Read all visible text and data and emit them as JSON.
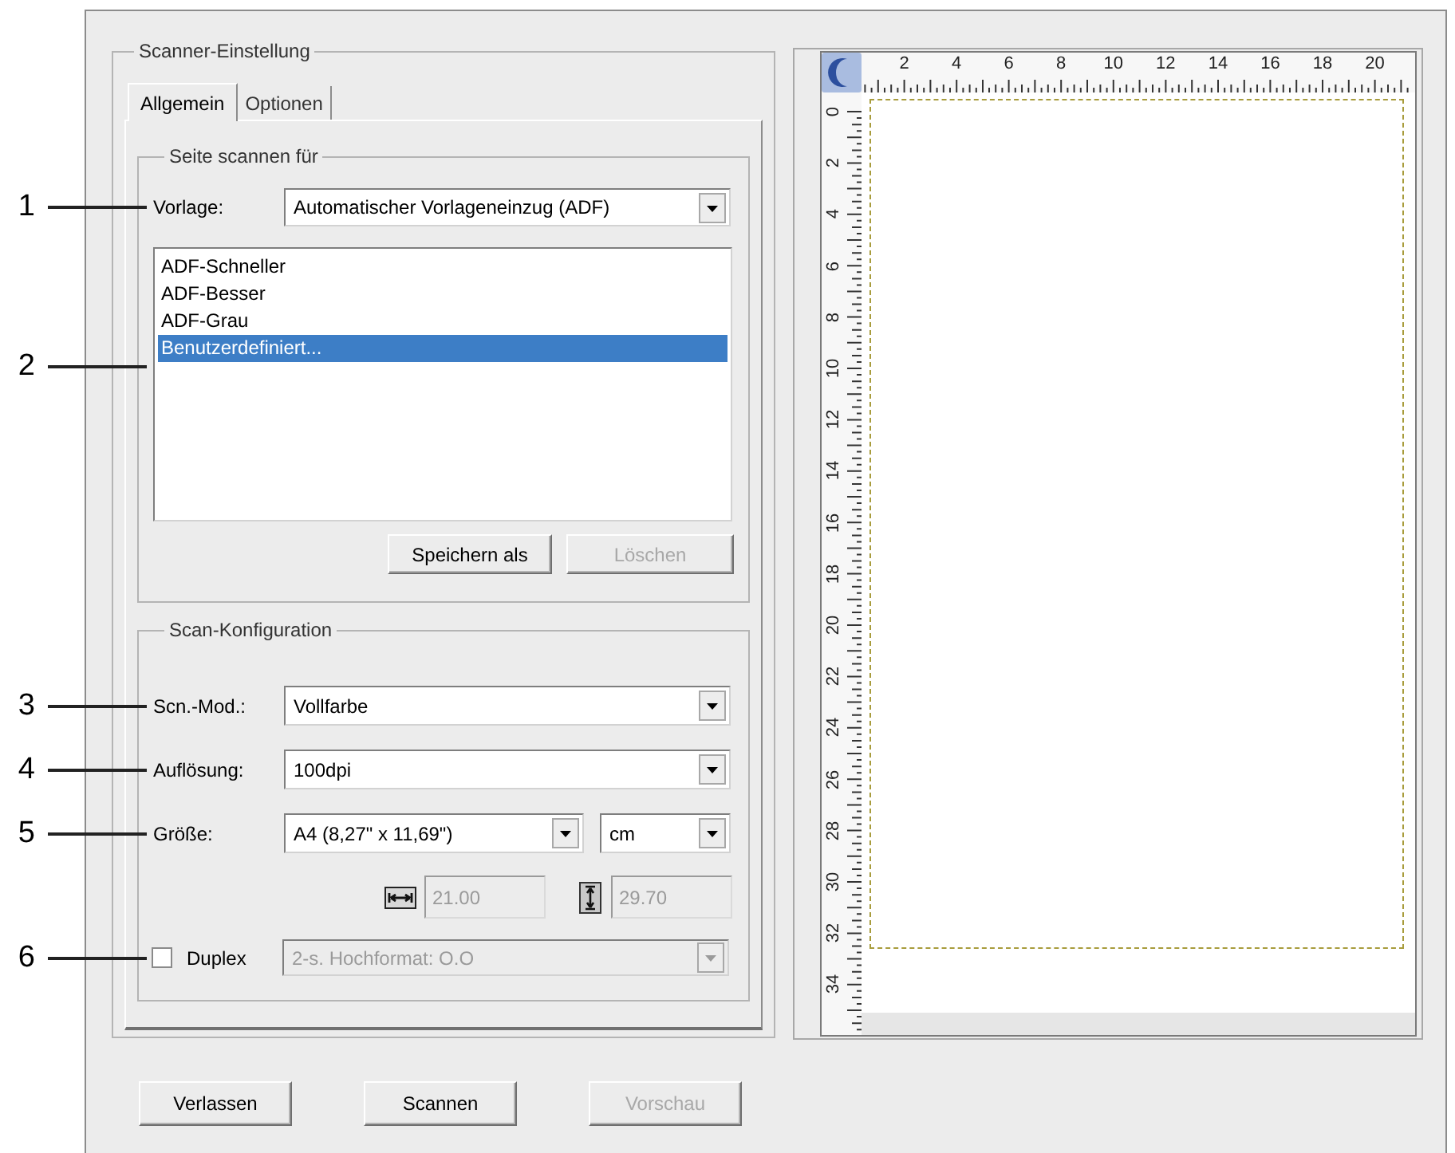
{
  "scanner_settings": {
    "title": "Scanner-Einstellung",
    "tabs": [
      {
        "label": "Allgemein",
        "selected": true
      },
      {
        "label": "Optionen",
        "selected": false
      }
    ],
    "scan_page_for": {
      "title": "Seite scannen für",
      "template": {
        "callout": "1",
        "label": "Vorlage:",
        "value": "Automatischer Vorlageneinzug (ADF)"
      },
      "preset_list": {
        "callout": "2",
        "items": [
          {
            "label": "ADF-Schneller",
            "selected": false
          },
          {
            "label": "ADF-Besser",
            "selected": false
          },
          {
            "label": "ADF-Grau",
            "selected": false
          },
          {
            "label": "Benutzerdefiniert...",
            "selected": true
          }
        ]
      },
      "buttons": [
        {
          "label": "Speichern als",
          "disabled": false
        },
        {
          "label": "Löschen",
          "disabled": true
        }
      ]
    },
    "scan_config": {
      "title": "Scan-Konfiguration",
      "mode": {
        "callout": "3",
        "label": "Scn.-Mod.:",
        "value": "Vollfarbe"
      },
      "resolution": {
        "callout": "4",
        "label": "Auflösung:",
        "value": "100dpi"
      },
      "size": {
        "callout": "5",
        "label": "Größe:",
        "value": "A4 (8,27\" x 11,69\")",
        "unit": "cm"
      },
      "width": {
        "value": "21.00",
        "disabled": true
      },
      "height": {
        "value": "29.70",
        "disabled": true
      },
      "duplex": {
        "callout": "6",
        "label": "Duplex",
        "checked": false,
        "value": "2-s. Hochformat: O.O",
        "disabled": true
      }
    }
  },
  "preview": {
    "ruler": {
      "horizontal_labels": [
        "2",
        "4",
        "6",
        "8",
        "10",
        "12",
        "14",
        "16",
        "18",
        "20"
      ],
      "vertical_labels": [
        "0",
        "2",
        "4",
        "6",
        "8",
        "10",
        "12",
        "14",
        "16",
        "18",
        "20",
        "22",
        "24",
        "26",
        "28",
        "30",
        "32",
        "34"
      ]
    }
  },
  "buttons": [
    {
      "label": "Verlassen",
      "disabled": false
    },
    {
      "label": "Scannen",
      "disabled": false
    },
    {
      "label": "Vorschau",
      "disabled": true
    }
  ]
}
